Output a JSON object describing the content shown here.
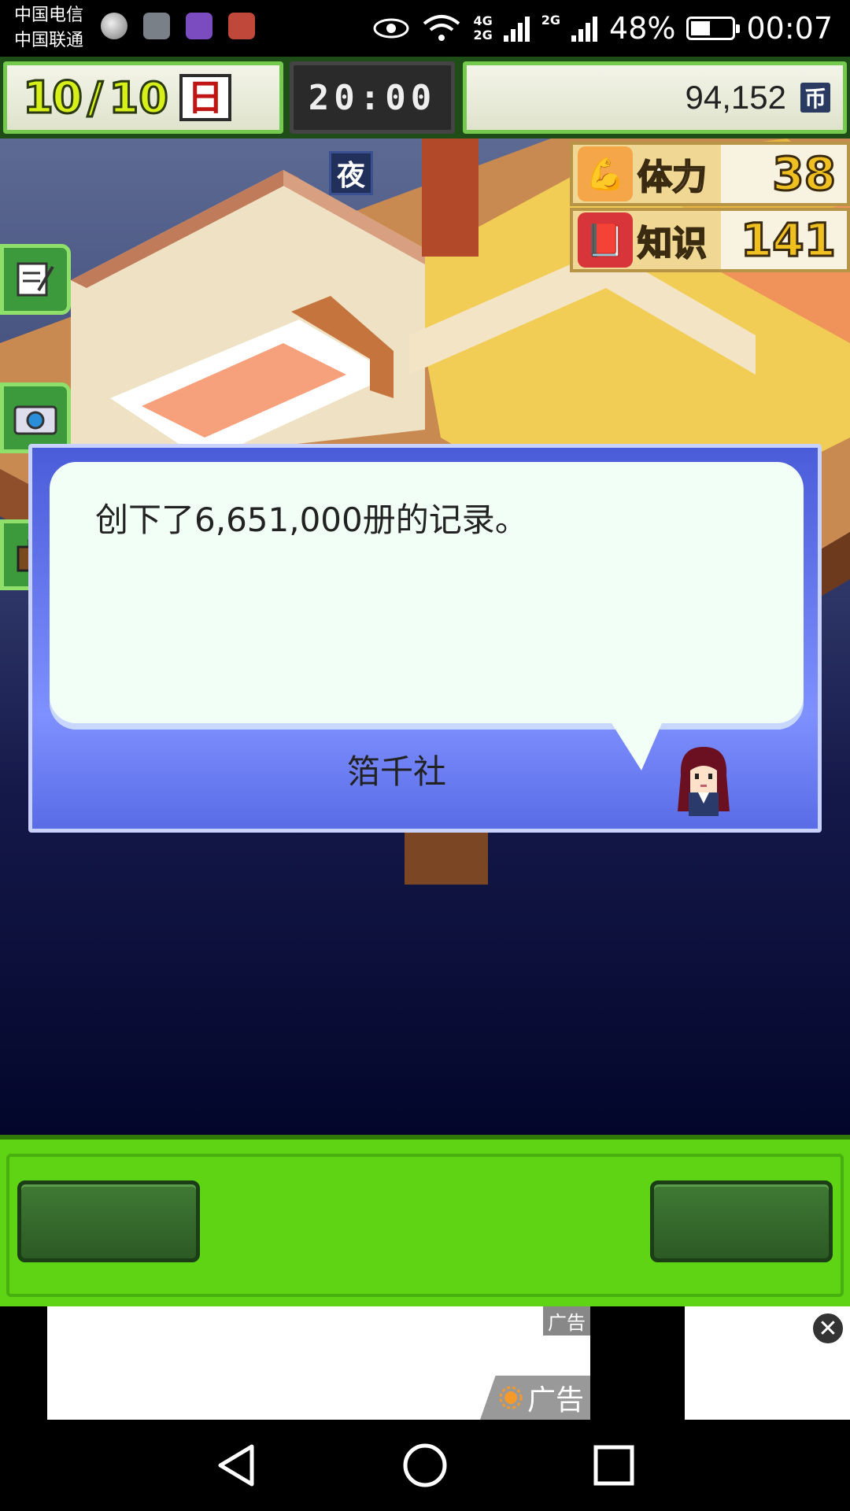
{
  "status_bar": {
    "carrier_1": "中国电信",
    "carrier_2": "中国联通",
    "network_1": "4G",
    "network_2": "2G",
    "network_3": "2G",
    "battery": "48%",
    "battery_level": 0.48,
    "time": "00:07"
  },
  "hud": {
    "month": "10",
    "day": "10",
    "weekday": "日",
    "clock": "20:00",
    "money": "94,152",
    "currency_icon": "币"
  },
  "scene": {
    "night_tag": "夜",
    "stats": [
      {
        "label": "体力",
        "value": "38",
        "icon": "muscle-icon"
      },
      {
        "label": "知识",
        "value": "141",
        "icon": "book-icon"
      }
    ]
  },
  "dialog": {
    "message": "创下了6,651,000册的记录。",
    "speaker": "箔千社"
  },
  "ad": {
    "tag_top": "广告",
    "tag_bottom": "广告"
  },
  "colors": {
    "panel_green": "#5fd414",
    "dialog_blue": "#6b7dff",
    "hud_border": "#74c94e"
  }
}
